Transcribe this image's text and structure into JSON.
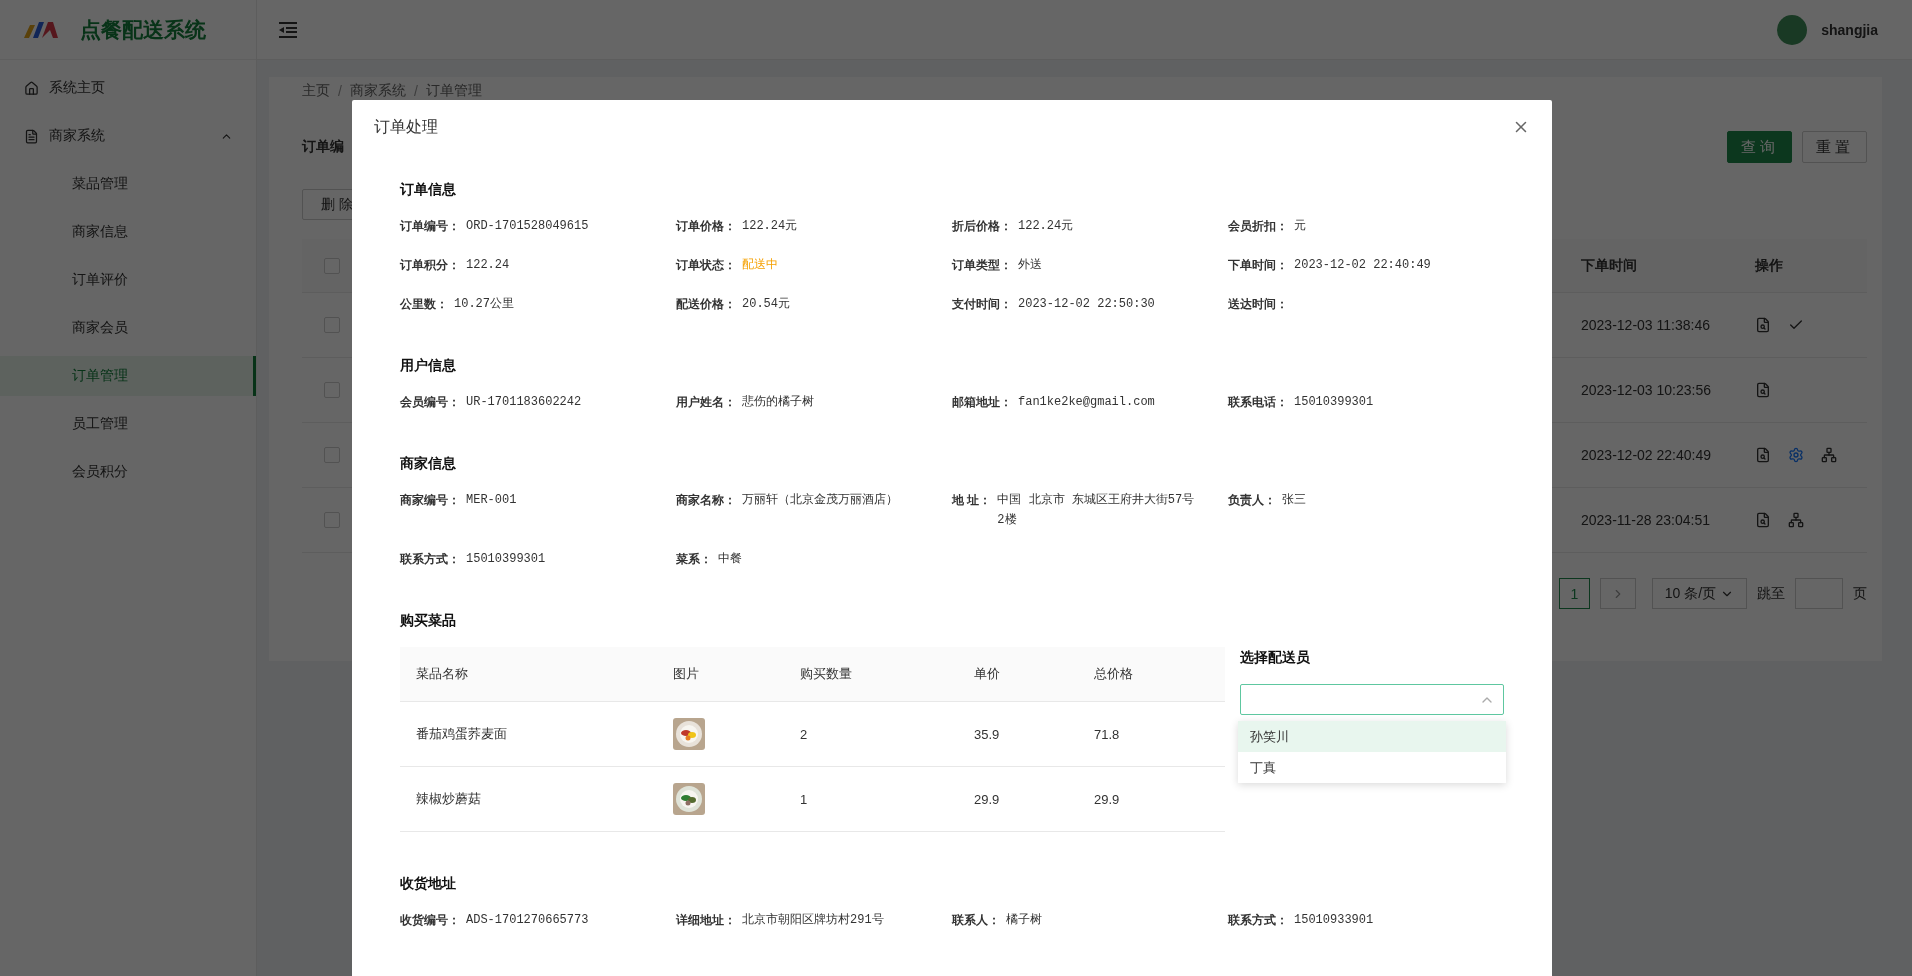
{
  "sidebar": {
    "title": "点餐配送系统",
    "items": [
      {
        "label": "系统主页",
        "kind": "home",
        "selected": false
      },
      {
        "label": "商家系统",
        "kind": "group",
        "expanded": true,
        "children": [
          {
            "label": "菜品管理",
            "selected": false
          },
          {
            "label": "商家信息",
            "selected": false
          },
          {
            "label": "订单评价",
            "selected": false
          },
          {
            "label": "商家会员",
            "selected": false
          },
          {
            "label": "订单管理",
            "selected": true
          },
          {
            "label": "员工管理",
            "selected": false
          },
          {
            "label": "会员积分",
            "selected": false
          }
        ]
      }
    ]
  },
  "header": {
    "username": "shangjia"
  },
  "breadcrumb": {
    "separator": "/",
    "items": [
      "主页",
      "商家系统",
      "订单管理"
    ]
  },
  "search": {
    "label": "订单编",
    "buttons": [
      {
        "label": "查询",
        "primary": true
      },
      {
        "label": "重置",
        "primary": false
      }
    ]
  },
  "delete_button": "删 除",
  "table": {
    "header_checked": false,
    "columns": [
      "下单时间",
      "操作"
    ],
    "rows": [
      {
        "checked": false,
        "time": "2023-12-03 11:38:46",
        "actions": [
          {
            "kind": "view"
          },
          {
            "kind": "confirm"
          }
        ]
      },
      {
        "checked": false,
        "time": "2023-12-03 10:23:56",
        "actions": [
          {
            "kind": "view"
          }
        ]
      },
      {
        "checked": false,
        "time": "2023-12-02 22:40:49",
        "actions": [
          {
            "kind": "view"
          },
          {
            "kind": "settings"
          },
          {
            "kind": "assign"
          }
        ]
      },
      {
        "checked": false,
        "time": "2023-11-28 23:04:51",
        "actions": [
          {
            "kind": "view"
          },
          {
            "kind": "assign"
          }
        ]
      }
    ]
  },
  "pagination": {
    "page": "1",
    "page_size": "10 条/页",
    "jump_label": "跳至",
    "page_suffix": "页"
  },
  "dialog": {
    "title": "订单处理",
    "sections": [
      {
        "kind": "fields",
        "title": "订单信息",
        "fields": [
          {
            "label": "订单编号：",
            "value": "ORD-1701528049615"
          },
          {
            "label": "订单价格：",
            "value": "122.24元"
          },
          {
            "label": "折后价格：",
            "value": "122.24元"
          },
          {
            "label": "会员折扣：",
            "value": "元"
          },
          {
            "label": "订单积分：",
            "value": "122.24"
          },
          {
            "label": "订单状态：",
            "value": "配送中",
            "kind": "status"
          },
          {
            "label": "订单类型：",
            "value": "外送"
          },
          {
            "label": "下单时间：",
            "value": "2023-12-02 22:40:49"
          },
          {
            "label": "公里数：",
            "value": "10.27公里"
          },
          {
            "label": "配送价格：",
            "value": "20.54元"
          },
          {
            "label": "支付时间：",
            "value": "2023-12-02 22:50:30"
          },
          {
            "label": "送达时间："
          }
        ]
      },
      {
        "kind": "fields",
        "title": "用户信息",
        "fields": [
          {
            "label": "会员编号：",
            "value": "UR-1701183602242"
          },
          {
            "label": "用户姓名：",
            "value": "悲伤的橘子树"
          },
          {
            "label": "邮箱地址：",
            "value": "fan1ke2ke@gmail.com"
          },
          {
            "label": "联系电话：",
            "value": "15010399301"
          }
        ]
      },
      {
        "kind": "fields",
        "title": "商家信息",
        "fields": [
          {
            "label": "商家编号：",
            "value": "MER-001"
          },
          {
            "label": "商家名称：",
            "value": "万丽轩（北京金茂万丽酒店）"
          },
          {
            "label": "地 址：",
            "value": "中国 北京市 东城区王府井大街57号2楼"
          },
          {
            "label": "负责人：",
            "value": "张三"
          },
          {
            "label": "联系方式：",
            "value": "15010399301"
          },
          {
            "label": "菜系：",
            "value": "中餐"
          }
        ]
      },
      {
        "kind": "dishes",
        "title": "购买菜品",
        "columns": [
          "菜品名称",
          "图片",
          "购买数量",
          "单价",
          "总价格"
        ],
        "rows": [
          {
            "name": "番茄鸡蛋荞麦面",
            "quantity": "2",
            "price": "35.9",
            "total": "71.8"
          },
          {
            "name": "辣椒炒蘑菇",
            "quantity": "1",
            "price": "29.9",
            "total": "29.9"
          }
        ],
        "courier": {
          "title": "选择配送员",
          "expanded": true,
          "options": [
            {
              "label": "孙笑川",
              "selected": true
            },
            {
              "label": "丁真",
              "selected": false
            }
          ]
        }
      },
      {
        "kind": "fields",
        "title": "收货地址",
        "fields": [
          {
            "label": "收货编号：",
            "value": "ADS-1701270665773"
          },
          {
            "label": "详细地址：",
            "value": "北京市朝阳区牌坊村291号"
          },
          {
            "label": "联系人：",
            "value": "橘子树"
          },
          {
            "label": "联系方式：",
            "value": "15010933901"
          }
        ]
      }
    ]
  }
}
